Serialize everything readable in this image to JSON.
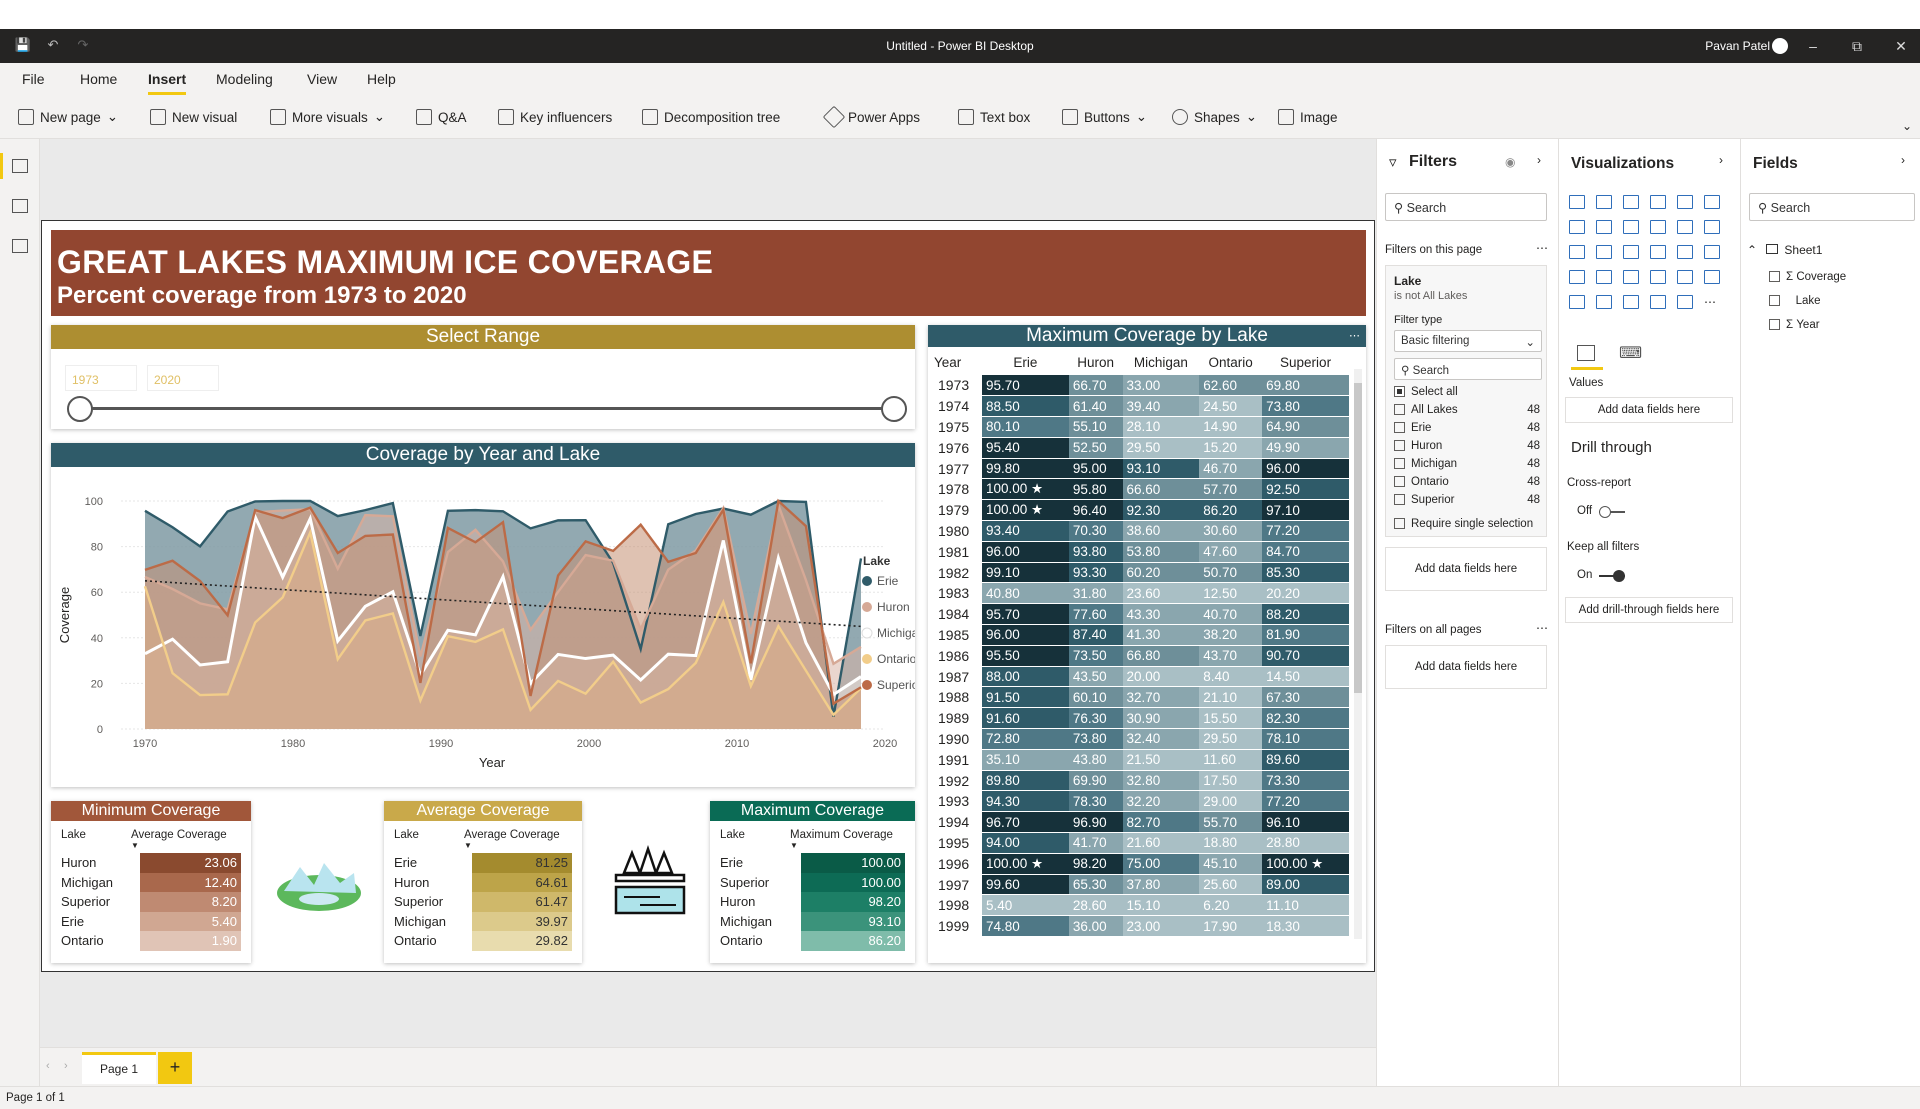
{
  "window": {
    "title": "Untitled - Power BI Desktop",
    "user": "Pavan Patel"
  },
  "menu": [
    "File",
    "Home",
    "Insert",
    "Modeling",
    "View",
    "Help"
  ],
  "ribbon": [
    "New page",
    "New visual",
    "More visuals",
    "Q&A",
    "Key influencers",
    "Decomposition tree",
    "Power Apps",
    "Text box",
    "Buttons",
    "Shapes",
    "Image"
  ],
  "report": {
    "title": "GREAT LAKES MAXIMUM ICE COVERAGE",
    "subtitle": "Percent coverage from 1973 to 2020",
    "slicer": {
      "title": "Select Range",
      "from": "1973",
      "to": "2020"
    },
    "colors": {
      "banner": "#924630",
      "slicer_head": "#ad8e31",
      "chart_head": "#2f5b69",
      "min_head": "#a1573a",
      "avg_head": "#c9a94a",
      "max_head": "#0a6b55",
      "erie": "#2f5b69",
      "huron": "#d6a996",
      "michigan": "#ffffff",
      "ontario": "#f2cd8a",
      "superior": "#bc6b47"
    }
  },
  "chart_data": {
    "type": "area",
    "title": "Coverage by Year and Lake",
    "xlabel": "Year",
    "ylabel": "Coverage",
    "xlim": [
      1970,
      2020
    ],
    "ylim": [
      0,
      100
    ],
    "xticks": [
      "1970",
      "1980",
      "1990",
      "2000",
      "2010",
      "2020"
    ],
    "yticks": [
      "0",
      "20",
      "40",
      "60",
      "80",
      "100"
    ],
    "legend_title": "Lake",
    "x": [
      1973,
      1974,
      1975,
      1976,
      1977,
      1978,
      1979,
      1980,
      1981,
      1982,
      1983,
      1984,
      1985,
      1986,
      1987,
      1988,
      1989,
      1990,
      1991,
      1992,
      1993,
      1994,
      1995,
      1996,
      1997,
      1998,
      1999
    ],
    "series": [
      {
        "name": "Erie",
        "values": [
          95.7,
          88.5,
          80.1,
          95.4,
          99.8,
          100,
          100,
          93.4,
          96.0,
          99.1,
          40.8,
          95.7,
          96.0,
          95.5,
          88.0,
          91.5,
          91.6,
          72.8,
          35.1,
          89.8,
          94.3,
          96.7,
          94.0,
          100,
          99.6,
          5.4,
          74.8
        ]
      },
      {
        "name": "Huron",
        "values": [
          66.7,
          61.4,
          55.1,
          52.5,
          95.0,
          95.8,
          96.4,
          70.3,
          93.8,
          93.3,
          31.8,
          77.6,
          87.4,
          73.5,
          43.5,
          60.1,
          76.3,
          73.8,
          43.8,
          69.9,
          78.3,
          96.9,
          41.7,
          98.2,
          65.3,
          28.6,
          36.0
        ]
      },
      {
        "name": "Michigan",
        "values": [
          33.0,
          39.4,
          28.1,
          29.5,
          93.1,
          66.6,
          92.3,
          38.6,
          53.8,
          60.2,
          23.6,
          43.3,
          41.3,
          66.8,
          20.0,
          32.7,
          30.9,
          32.4,
          21.5,
          32.8,
          32.2,
          82.7,
          21.6,
          75.0,
          37.8,
          15.1,
          23.0
        ]
      },
      {
        "name": "Ontario",
        "values": [
          62.6,
          24.5,
          14.9,
          15.2,
          46.7,
          57.7,
          86.2,
          30.6,
          47.6,
          50.7,
          12.5,
          40.7,
          38.2,
          43.7,
          8.4,
          21.1,
          15.5,
          29.5,
          11.6,
          17.5,
          29.0,
          55.7,
          18.8,
          45.1,
          25.6,
          6.2,
          17.9
        ]
      },
      {
        "name": "Superior",
        "values": [
          69.8,
          73.8,
          64.9,
          49.9,
          96.0,
          92.5,
          97.1,
          77.2,
          84.7,
          85.3,
          20.2,
          88.2,
          81.9,
          90.7,
          14.5,
          67.3,
          82.3,
          78.1,
          89.6,
          73.3,
          77.2,
          96.1,
          28.8,
          100,
          89.0,
          11.1,
          18.3
        ]
      }
    ]
  },
  "maxtable": {
    "title": "Maximum Coverage by Lake",
    "headers": [
      "Year",
      "Erie",
      "Huron",
      "Michigan",
      "Ontario",
      "Superior"
    ],
    "rows": [
      [
        "1973",
        "95.70",
        "66.70",
        "33.00",
        "62.60",
        "69.80"
      ],
      [
        "1974",
        "88.50",
        "61.40",
        "39.40",
        "24.50",
        "73.80"
      ],
      [
        "1975",
        "80.10",
        "55.10",
        "28.10",
        "14.90",
        "64.90"
      ],
      [
        "1976",
        "95.40",
        "52.50",
        "29.50",
        "15.20",
        "49.90"
      ],
      [
        "1977",
        "99.80",
        "95.00",
        "93.10",
        "46.70",
        "96.00"
      ],
      [
        "1978",
        "100.00 ★",
        "95.80",
        "66.60",
        "57.70",
        "92.50"
      ],
      [
        "1979",
        "100.00 ★",
        "96.40",
        "92.30",
        "86.20",
        "97.10"
      ],
      [
        "1980",
        "93.40",
        "70.30",
        "38.60",
        "30.60",
        "77.20"
      ],
      [
        "1981",
        "96.00",
        "93.80",
        "53.80",
        "47.60",
        "84.70"
      ],
      [
        "1982",
        "99.10",
        "93.30",
        "60.20",
        "50.70",
        "85.30"
      ],
      [
        "1983",
        "40.80",
        "31.80",
        "23.60",
        "12.50",
        "20.20"
      ],
      [
        "1984",
        "95.70",
        "77.60",
        "43.30",
        "40.70",
        "88.20"
      ],
      [
        "1985",
        "96.00",
        "87.40",
        "41.30",
        "38.20",
        "81.90"
      ],
      [
        "1986",
        "95.50",
        "73.50",
        "66.80",
        "43.70",
        "90.70"
      ],
      [
        "1987",
        "88.00",
        "43.50",
        "20.00",
        "8.40",
        "14.50"
      ],
      [
        "1988",
        "91.50",
        "60.10",
        "32.70",
        "21.10",
        "67.30"
      ],
      [
        "1989",
        "91.60",
        "76.30",
        "30.90",
        "15.50",
        "82.30"
      ],
      [
        "1990",
        "72.80",
        "73.80",
        "32.40",
        "29.50",
        "78.10"
      ],
      [
        "1991",
        "35.10",
        "43.80",
        "21.50",
        "11.60",
        "89.60"
      ],
      [
        "1992",
        "89.80",
        "69.90",
        "32.80",
        "17.50",
        "73.30"
      ],
      [
        "1993",
        "94.30",
        "78.30",
        "32.20",
        "29.00",
        "77.20"
      ],
      [
        "1994",
        "96.70",
        "96.90",
        "82.70",
        "55.70",
        "96.10"
      ],
      [
        "1995",
        "94.00",
        "41.70",
        "21.60",
        "18.80",
        "28.80"
      ],
      [
        "1996",
        "100.00 ★",
        "98.20",
        "75.00",
        "45.10",
        "100.00 ★"
      ],
      [
        "1997",
        "99.60",
        "65.30",
        "37.80",
        "25.60",
        "89.00"
      ],
      [
        "1998",
        "5.40",
        "28.60",
        "15.10",
        "6.20",
        "11.10"
      ],
      [
        "1999",
        "74.80",
        "36.00",
        "23.00",
        "17.90",
        "18.30"
      ]
    ]
  },
  "kpis": [
    {
      "title": "Minimum Coverage",
      "col1": "Lake",
      "col2": "Average Coverage",
      "rows": [
        [
          "Huron",
          "23.06"
        ],
        [
          "Michigan",
          "12.40"
        ],
        [
          "Superior",
          "8.20"
        ],
        [
          "Erie",
          "5.40"
        ],
        [
          "Ontario",
          "1.90"
        ]
      ]
    },
    {
      "title": "Average Coverage",
      "col1": "Lake",
      "col2": "Average Coverage",
      "rows": [
        [
          "Erie",
          "81.25"
        ],
        [
          "Huron",
          "64.61"
        ],
        [
          "Superior",
          "61.47"
        ],
        [
          "Michigan",
          "39.97"
        ],
        [
          "Ontario",
          "29.82"
        ]
      ]
    },
    {
      "title": "Maximum Coverage",
      "col1": "Lake",
      "col2": "Maximum Coverage",
      "rows": [
        [
          "Erie",
          "100.00"
        ],
        [
          "Superior",
          "100.00"
        ],
        [
          "Huron",
          "98.20"
        ],
        [
          "Michigan",
          "93.10"
        ],
        [
          "Ontario",
          "86.20"
        ]
      ]
    }
  ],
  "filters": {
    "title": "Filters",
    "search": "Search",
    "on_page": "Filters on this page",
    "card_title": "Lake",
    "card_sub": "is not All Lakes",
    "filter_type_label": "Filter type",
    "filter_type": "Basic filtering",
    "card_search": "Search",
    "items": [
      [
        "Select all",
        ""
      ],
      [
        "All Lakes",
        "48"
      ],
      [
        "Erie",
        "48"
      ],
      [
        "Huron",
        "48"
      ],
      [
        "Michigan",
        "48"
      ],
      [
        "Ontario",
        "48"
      ],
      [
        "Superior",
        "48"
      ]
    ],
    "require_single": "Require single selection",
    "add1": "Add data fields here",
    "on_all": "Filters on all pages",
    "add2": "Add data fields here"
  },
  "viz": {
    "title": "Visualizations",
    "values": "Values",
    "add_values": "Add data fields here",
    "drill": "Drill through",
    "cross": "Cross-report",
    "off": "Off",
    "keep": "Keep all filters",
    "on": "On",
    "add_drill": "Add drill-through fields here"
  },
  "fields": {
    "title": "Fields",
    "search": "Search",
    "table": "Sheet1",
    "items": [
      "Coverage",
      "Lake",
      "Year"
    ]
  },
  "pages": {
    "tab": "Page 1",
    "status": "Page 1 of 1"
  }
}
